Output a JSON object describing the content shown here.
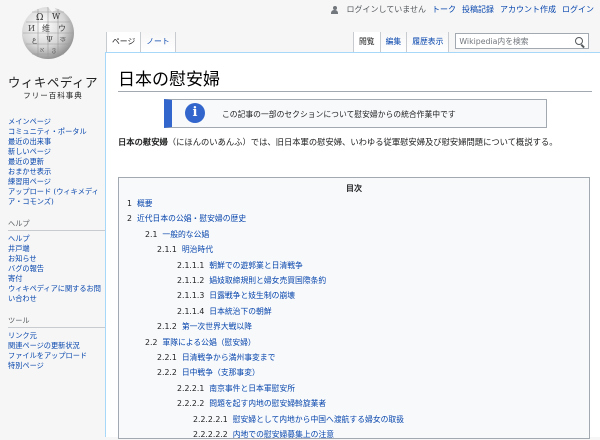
{
  "personal_tools": {
    "status": "ログインしていません",
    "links": [
      "トーク",
      "投稿記録",
      "アカウント作成",
      "ログイン"
    ]
  },
  "logo": {
    "title": "ウィキペディア",
    "subtitle": "フリー百科事典"
  },
  "tabs_left": [
    "ページ",
    "ノート"
  ],
  "tabs_right": [
    "閲覧",
    "編集",
    "履歴表示"
  ],
  "search": {
    "placeholder": "Wikipedia内を検索"
  },
  "sidebar": {
    "main": [
      "メインページ",
      "コミュニティ・ポータル",
      "最近の出来事",
      "新しいページ",
      "最近の更新",
      "おまかせ表示",
      "練習用ページ",
      "アップロード (ウィキメディア・コモンズ)"
    ],
    "help_heading": "ヘルプ",
    "help": [
      "ヘルプ",
      "井戸端",
      "お知らせ",
      "バグの報告",
      "寄付",
      "ウィキペディアに関するお問い合わせ"
    ],
    "tools_heading": "ツール",
    "tools": [
      "リンク元",
      "関連ページの更新状況",
      "ファイルをアップロード",
      "特別ページ"
    ]
  },
  "page": {
    "title": "日本の慰安婦",
    "notice": "この記事の一部のセクションについて慰安婦からの統合作業中です",
    "lead_bold": "日本の慰安婦",
    "lead_rest": "（にほんのいあんふ）では、旧日本軍の慰安婦、いわゆる従軍慰安婦及び慰安婦問題について概説する。"
  },
  "toc": {
    "title": "目次",
    "entries": [
      {
        "num": "1",
        "label": "概要"
      },
      {
        "num": "2",
        "label": "近代日本の公娼・慰安婦の歴史"
      },
      {
        "num": "2.1",
        "label": "一般的な公娼"
      },
      {
        "num": "2.1.1",
        "label": "明治時代"
      },
      {
        "num": "2.1.1.1",
        "label": "朝鮮での遊郭業と日清戦争"
      },
      {
        "num": "2.1.1.2",
        "label": "娼妓取締規則と婦女売買国際条約"
      },
      {
        "num": "2.1.1.3",
        "label": "日露戦争と妓生制の崩壊"
      },
      {
        "num": "2.1.1.4",
        "label": "日本統治下の朝鮮"
      },
      {
        "num": "2.1.2",
        "label": "第一次世界大戦以降"
      },
      {
        "num": "2.2",
        "label": "軍隊による公娼（慰安婦）"
      },
      {
        "num": "2.2.1",
        "label": "日清戦争から満州事変まで"
      },
      {
        "num": "2.2.2",
        "label": "日中戦争（支那事変）"
      },
      {
        "num": "2.2.2.1",
        "label": "南京事件と日本軍慰安所"
      },
      {
        "num": "2.2.2.2",
        "label": "問題を起す内地の慰安婦斡旋業者"
      },
      {
        "num": "2.2.2.2.1",
        "label": "慰安婦として内地から中国へ渡航する婦女の取扱"
      },
      {
        "num": "2.2.2.2.2",
        "label": "内地での慰安婦募集上の注意"
      }
    ]
  },
  "colors": {
    "link": "#0645ad",
    "accent": "#3366cc",
    "border": "#a2a9b1"
  }
}
